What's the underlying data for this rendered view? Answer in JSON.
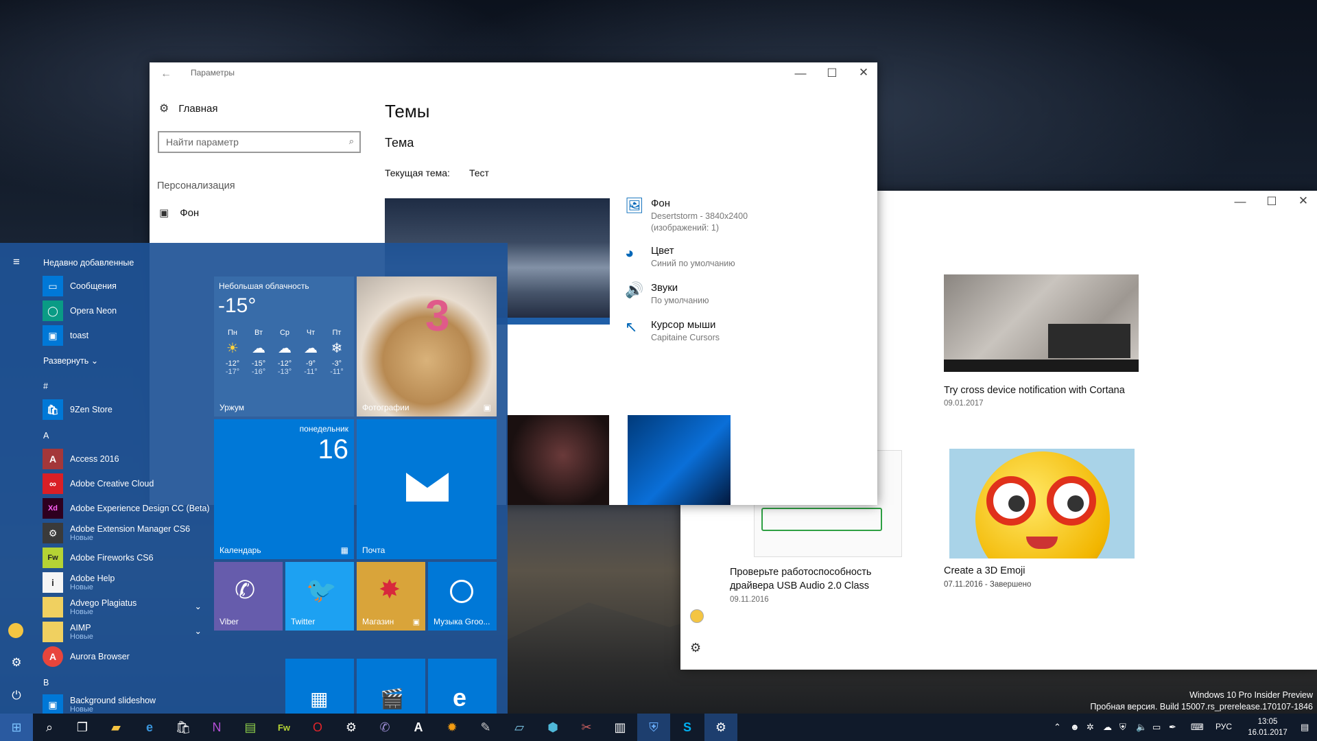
{
  "settings": {
    "title": "Параметры",
    "home": "Главная",
    "search_placeholder": "Найти параметр",
    "section": "Персонализация",
    "nav_item": "Фон",
    "page_title": "Темы",
    "subtitle": "Тема",
    "current_theme_label": "Текущая тема:",
    "current_theme_value": "Тест",
    "items": [
      {
        "title": "Фон",
        "sub1": "Desertstorm - 3840x2400",
        "sub2": "(изображений: 1)"
      },
      {
        "title": "Цвет",
        "sub1": "Синий по умолчанию"
      },
      {
        "title": "Звуки",
        "sub1": "По умолчанию"
      },
      {
        "title": "Курсор мыши",
        "sub1": "Capitaine Cursors"
      }
    ]
  },
  "feedback": {
    "cards": [
      {
        "title": "Try cross device notification with Cortana",
        "date": "09.01.2017"
      },
      {
        "title": "Проверьте работоспособность драйвера USB Audio 2.0 Class",
        "date": "09.11.2016"
      },
      {
        "title": "Create a 3D Emoji",
        "date": "07.11.2016 - Завершено"
      }
    ]
  },
  "start": {
    "recent_header": "Недавно добавленные",
    "expand": "Развернуть",
    "recent": [
      "Сообщения",
      "Opera Neon",
      "toast"
    ],
    "hash_letter": "#",
    "a_letter": "A",
    "b_letter": "B",
    "apps": [
      {
        "name": "9Zen Store"
      },
      {
        "name": "Access 2016"
      },
      {
        "name": "Adobe Creative Cloud"
      },
      {
        "name": "Adobe Experience Design CC (Beta)"
      },
      {
        "name": "Adobe Extension Manager CS6",
        "sub": "Новые"
      },
      {
        "name": "Adobe Fireworks CS6"
      },
      {
        "name": "Adobe Help",
        "sub": "Новые"
      },
      {
        "name": "Advego Plagiatus",
        "sub": "Новые"
      },
      {
        "name": "AIMP",
        "sub": "Новые"
      },
      {
        "name": "Aurora Browser"
      },
      {
        "name": "Background slideshow",
        "sub": "Новые"
      }
    ],
    "weather": {
      "condition": "Небольшая облачность",
      "temp": "-15°",
      "city": "Уржум",
      "days": [
        {
          "d": "Пн",
          "hi": "-12°",
          "lo": "-17°"
        },
        {
          "d": "Вт",
          "hi": "-15°",
          "lo": "-16°"
        },
        {
          "d": "Ср",
          "hi": "-12°",
          "lo": "-13°"
        },
        {
          "d": "Чт",
          "hi": "-9°",
          "lo": "-11°"
        },
        {
          "d": "Пт",
          "hi": "-3°",
          "lo": "-11°"
        }
      ]
    },
    "photos_label": "Фотографии",
    "calendar": {
      "weekday": "понедельник",
      "day": "16",
      "label": "Календарь"
    },
    "mail_label": "Почта",
    "viber_label": "Viber",
    "twitter_label": "Twitter",
    "store_label": "Магазин",
    "music_label": "Музыка Groo..."
  },
  "watermark": {
    "line1": "Windows 10 Pro Insider Preview",
    "line2": "Пробная версия. Build 15007.rs_prerelease.170107-1846"
  },
  "taskbar": {
    "lang": "РУС",
    "time": "13:05",
    "date": "16.01.2017"
  }
}
